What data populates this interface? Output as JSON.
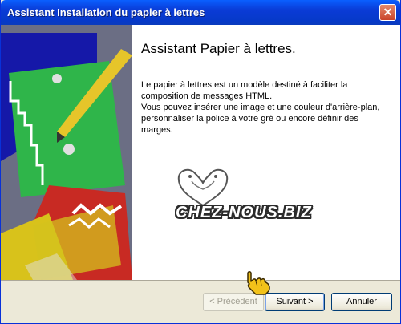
{
  "window": {
    "title": "Assistant Installation du papier à lettres"
  },
  "main": {
    "heading": "Assistant Papier à lettres.",
    "paragraph1": "Le papier à lettres est un modèle destiné à faciliter la composition de messages HTML.",
    "paragraph2": "Vous pouvez insérer une image et une couleur d'arrière-plan, personnaliser la police à votre gré ou encore définir des marges."
  },
  "watermark": {
    "text": "CHEZ-NOUS.BIZ"
  },
  "buttons": {
    "previous": "< Précédent",
    "next": "Suivant >",
    "cancel": "Annuler"
  },
  "icons": {
    "close": "close-icon",
    "cursor": "pointing-hand-cursor-icon",
    "decoration": "doves-heart-icon"
  },
  "colors": {
    "titlebar": "#0a3bd6",
    "accent_focus": "#7ba2e7"
  }
}
